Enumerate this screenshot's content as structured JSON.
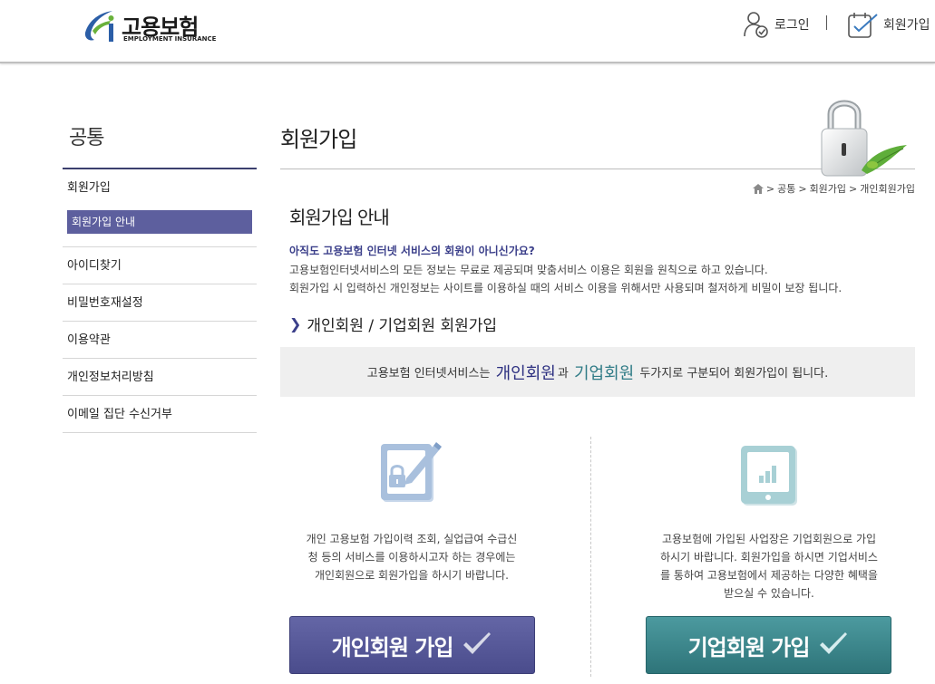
{
  "header": {
    "logo_title": "고용보험",
    "logo_sub": "EMPLOYMENT INSURANCE",
    "login_label": "로그인",
    "join_label": "회원가입"
  },
  "sidebar": {
    "title": "공통",
    "items": [
      {
        "label": "회원가입"
      },
      {
        "label": "회원가입 안내",
        "active": true
      },
      {
        "label": "아이디찾기"
      },
      {
        "label": "비밀번호재설정"
      },
      {
        "label": "이용약관"
      },
      {
        "label": "개인정보처리방침"
      },
      {
        "label": "이메일 집단 수신거부"
      }
    ]
  },
  "main": {
    "page_title": "회원가입",
    "breadcrumb": [
      "공통",
      "회원가입",
      "개인회원가입"
    ],
    "section_title": "회원가입 안내",
    "intro_question": "아직도 고용보험 인터넷 서비스의 회원이 아니신가요?",
    "intro_line1": "고용보험인터넷서비스의 모든 정보는 무료로 제공되며 맞춤서비스 이용은 회원을 원칙으로 하고 있습니다.",
    "intro_line2": "회원가입 시 입력하신 개인정보는 사이트를 이용하실 때의 서비스 이용을 위해서만 사용되며 철저하게 비밀이 보장 됩니다.",
    "sub_title": "개인회원 / 기업회원 회원가입",
    "notice_prefix": "고용보험 인터넷서비스는",
    "notice_personal": "개인회원",
    "notice_and": "과",
    "notice_company": "기업회원",
    "notice_suffix": "두가지로 구분되어 회원가입이 됩니다.",
    "personal_desc": "개인 고용보험 가입이력 조회, 실업급여 수급신청 등의 서비스를 이용하시고자 하는 경우에는 개인회원으로 회원가입을 하시기 바랍니다.",
    "company_desc": "고용보험에 가입된 사업장은 기업회원으로 가입 하시기 바랍니다. 회원가입을 하시면 기업서비스를 통하여 고용보험에서 제공하는 다양한 혜택을 받으실 수 있습니다.",
    "personal_button": "개인회원 가입",
    "company_button": "기업회원 가입"
  },
  "colors": {
    "accent_navy": "#5d5f9e",
    "accent_teal": "#2f7b86",
    "notice_bg": "#efefef"
  },
  "icons": [
    "user-check-icon",
    "join-form-icon",
    "home-icon",
    "lock-image",
    "personal-edit-icon",
    "company-tablet-icon",
    "checkmark-icon"
  ]
}
